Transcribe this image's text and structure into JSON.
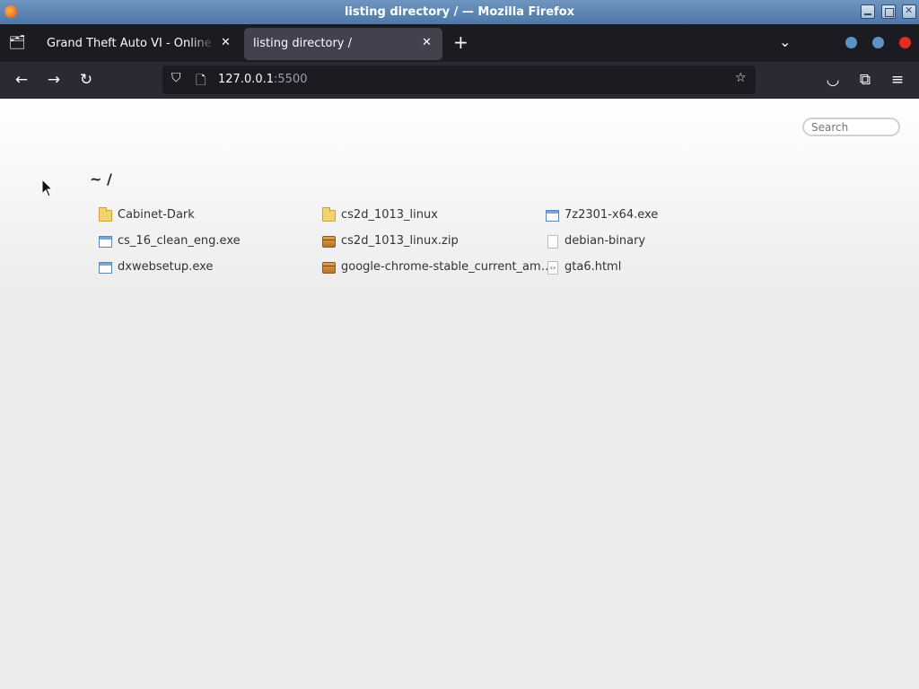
{
  "window": {
    "title": "listing directory / — Mozilla Firefox"
  },
  "tabs": [
    {
      "label": "Grand Theft Auto VI - Online Ga",
      "active": false
    },
    {
      "label": "listing directory /",
      "active": true
    }
  ],
  "navbar": {
    "url_host": "127.0.0.1",
    "url_port": ":5500"
  },
  "page": {
    "search_placeholder": "Search",
    "heading": "~ /",
    "files": [
      {
        "name": "Cabinet-Dark",
        "type": "folder"
      },
      {
        "name": "cs2d_1013_linux",
        "type": "folder"
      },
      {
        "name": "7z2301-x64.exe",
        "type": "exe"
      },
      {
        "name": "cs_16_clean_eng.exe",
        "type": "exe"
      },
      {
        "name": "cs2d_1013_linux.zip",
        "type": "zip"
      },
      {
        "name": "debian-binary",
        "type": "blank"
      },
      {
        "name": "dxwebsetup.exe",
        "type": "exe"
      },
      {
        "name": "google-chrome-stable_current_am…",
        "type": "zip"
      },
      {
        "name": "gta6.html",
        "type": "html"
      }
    ]
  },
  "colors": {
    "titlebar": "#4d78a8",
    "tabstrip": "#1c1b22",
    "navbar": "#2b2a33",
    "close_dot": "#e22c1f",
    "dot": "#5b93c8"
  }
}
